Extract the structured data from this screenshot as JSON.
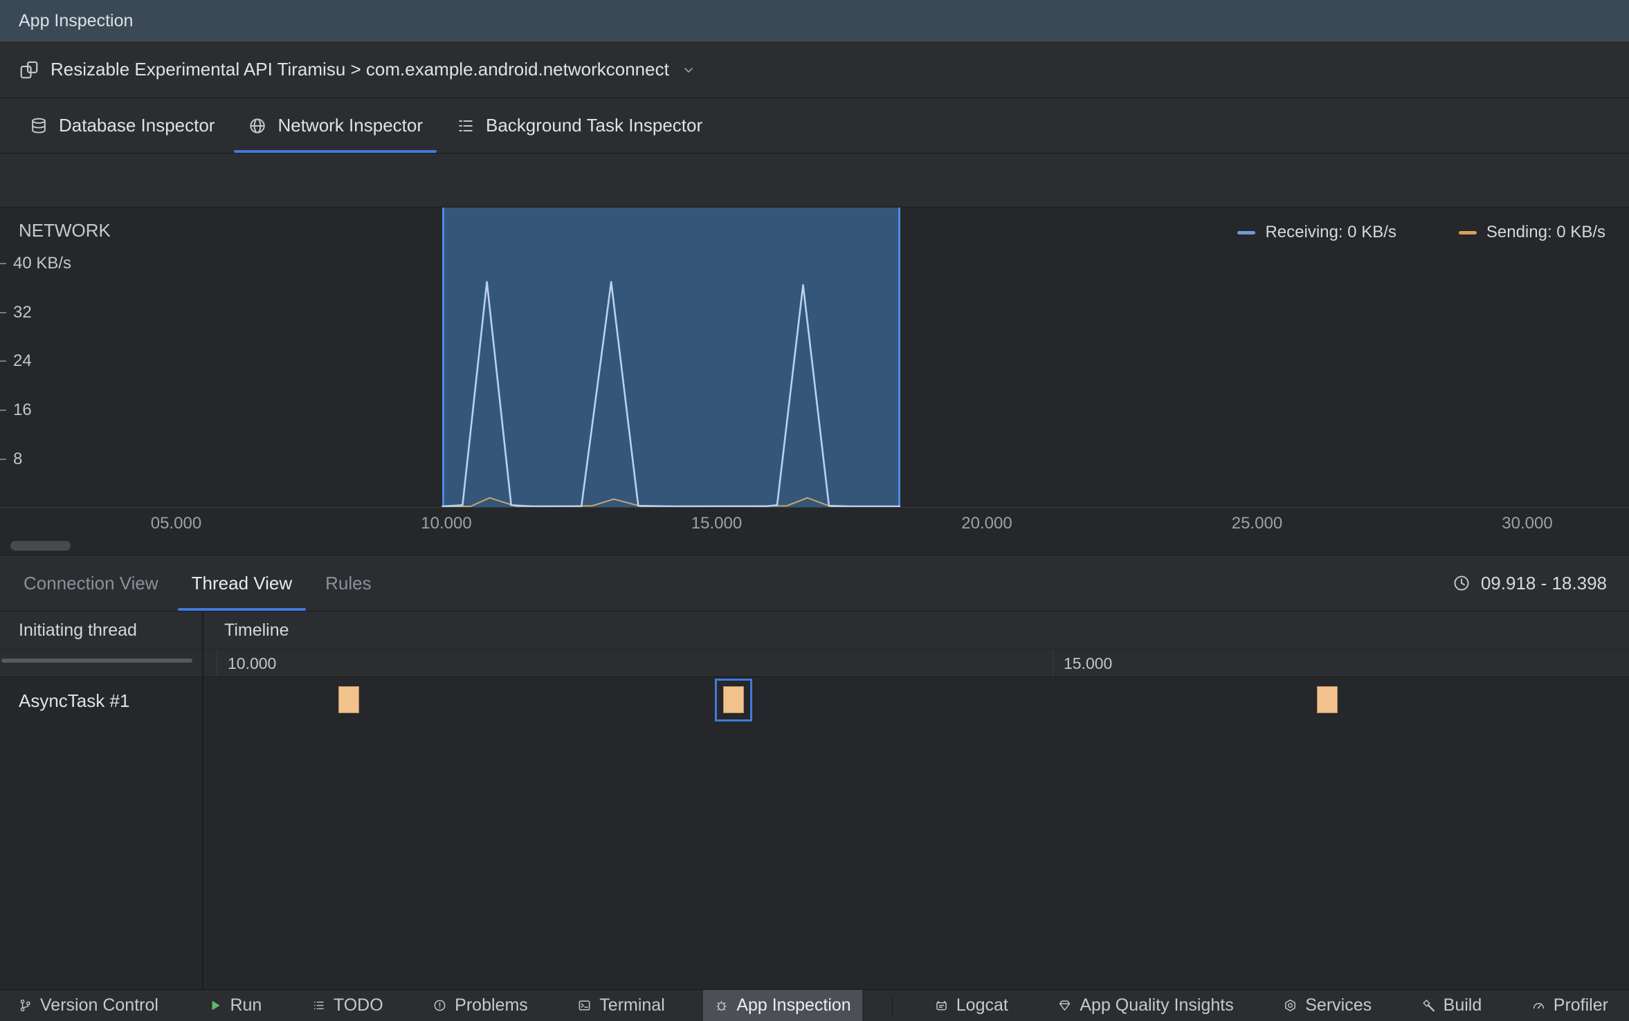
{
  "colors": {
    "accent_blue": "#3F7AE0",
    "selection_fill": "#345679",
    "selection_border": "#4D8BE4",
    "event_block": "#F2C28C"
  },
  "title_bar": {
    "title": "App Inspection"
  },
  "device_bar": {
    "label": "Resizable Experimental API Tiramisu > com.example.android.networkconnect"
  },
  "inspector_tabs": [
    {
      "label": "Database Inspector",
      "icon": "database-icon",
      "selected": false
    },
    {
      "label": "Network Inspector",
      "icon": "network-icon",
      "selected": true
    },
    {
      "label": "Background Task Inspector",
      "icon": "background-task-icon",
      "selected": false
    }
  ],
  "chart_data": {
    "type": "line",
    "title": "NETWORK",
    "ylabel_unit": "KB/s",
    "xlim": [
      1.74,
      31.9
    ],
    "ylim": [
      0,
      40
    ],
    "x_ticks": [
      "05.000",
      "10.000",
      "15.000",
      "20.000",
      "25.000",
      "30.000"
    ],
    "x_tick_values": [
      5,
      10,
      15,
      20,
      25,
      30
    ],
    "y_ticks": [
      "40 KB/s",
      "32",
      "24",
      "16",
      "8"
    ],
    "y_tick_values": [
      40,
      32,
      24,
      16,
      8
    ],
    "selection": {
      "start": 9.918,
      "end": 18.398
    },
    "series": [
      {
        "name": "Receiving: 0 KB/s",
        "color": "#6E9BD9",
        "line_color": "#B9D1EE",
        "points": [
          [
            9.918,
            0.1
          ],
          [
            10.3,
            0.5
          ],
          [
            10.75,
            37
          ],
          [
            11.2,
            0.5
          ],
          [
            11.6,
            0.15
          ],
          [
            12.5,
            0.3
          ],
          [
            13.05,
            37
          ],
          [
            13.55,
            0.4
          ],
          [
            14.2,
            0.15
          ],
          [
            15.9,
            0.2
          ],
          [
            16.12,
            0.5
          ],
          [
            16.6,
            36.5
          ],
          [
            17.08,
            0.4
          ],
          [
            17.5,
            0.15
          ],
          [
            18.398,
            0.1
          ]
        ]
      },
      {
        "name": "Sending: 0 KB/s",
        "color": "#DC9E58",
        "line_color": "#CFA26E",
        "points": [
          [
            9.918,
            0.1
          ],
          [
            10.45,
            0.3
          ],
          [
            10.8,
            1.7
          ],
          [
            11.3,
            0.3
          ],
          [
            12.7,
            0.4
          ],
          [
            13.1,
            1.5
          ],
          [
            13.6,
            0.3
          ],
          [
            16.3,
            0.4
          ],
          [
            16.68,
            1.7
          ],
          [
            17.1,
            0.2
          ],
          [
            18.398,
            0.1
          ]
        ]
      }
    ]
  },
  "detail_panel": {
    "tabs": [
      {
        "label": "Connection View",
        "selected": false
      },
      {
        "label": "Thread View",
        "selected": true
      },
      {
        "label": "Rules",
        "selected": false
      }
    ],
    "time_range": "09.918 - 18.398",
    "columns": [
      "Initiating thread",
      "Timeline"
    ],
    "timeline_ticks": [
      {
        "label": "10.000",
        "time": 10
      },
      {
        "label": "15.000",
        "time": 15
      }
    ],
    "rows": [
      {
        "thread": "AsyncTask #1",
        "events": [
          {
            "time": 10.75,
            "selected": false
          },
          {
            "time": 13.05,
            "selected": true
          },
          {
            "time": 16.6,
            "selected": false
          }
        ]
      }
    ]
  },
  "status_bar": {
    "items": [
      {
        "label": "Version Control",
        "icon": "branch-icon",
        "selected": false
      },
      {
        "label": "Run",
        "icon": "run-icon",
        "selected": false
      },
      {
        "label": "TODO",
        "icon": "todo-icon",
        "selected": false
      },
      {
        "label": "Problems",
        "icon": "problems-icon",
        "selected": false
      },
      {
        "label": "Terminal",
        "icon": "terminal-icon",
        "selected": false
      },
      {
        "label": "App Inspection",
        "icon": "app-inspection-icon",
        "selected": true,
        "divider_after": true
      },
      {
        "label": "Logcat",
        "icon": "logcat-icon",
        "selected": false
      },
      {
        "label": "App Quality Insights",
        "icon": "insights-icon",
        "selected": false
      },
      {
        "label": "Services",
        "icon": "services-icon",
        "selected": false
      },
      {
        "label": "Build",
        "icon": "build-icon",
        "selected": false
      },
      {
        "label": "Profiler",
        "icon": "profiler-icon",
        "selected": false
      }
    ]
  }
}
